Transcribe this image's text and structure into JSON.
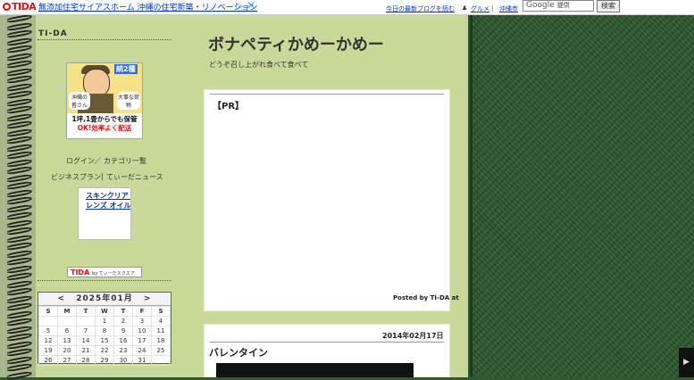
{
  "topbar": {
    "logo_text": "TIDA",
    "ad_text": "無添加住宅サイアスホーム 沖縄の住宅新築・リノベーション",
    "play_glyph": "▷",
    "close_glyph": "✕",
    "link_latest": "今日の最新ブログを読む",
    "link_gourmet": "グルメ",
    "separator": "|",
    "link_okinawa": "沖縄市",
    "search_brand": "Google",
    "search_provider": "提供",
    "search_button": "検索"
  },
  "sidebar": {
    "title": "TI-DA",
    "banner": {
      "tag": "続2種",
      "bubble_left": "沖縄の皆さん",
      "bubble_right": "大事な荷物",
      "line1": "1坪,1畳からでも保管",
      "line2": "OK!効率よく配送"
    },
    "login": "ログイン",
    "slash": "／",
    "category": "カテゴリ一覧",
    "business": "ビジネスプラン",
    "pipe": "|",
    "news": "てぃーだニュース",
    "ad_line1": "スキンクリア ク",
    "ad_line2": "レンズ オイル ",
    "badge_main": "TIDA",
    "badge_small": "by てぃーだスクエア",
    "calendar": {
      "prev": "<",
      "next": ">",
      "title": "2025年01月",
      "dow": [
        "S",
        "M",
        "T",
        "W",
        "T",
        "F",
        "S"
      ],
      "weeks": [
        [
          "",
          "",
          "",
          "1",
          "2",
          "3",
          "4"
        ],
        [
          "5",
          "6",
          "7",
          "8",
          "9",
          "10",
          "11"
        ],
        [
          "12",
          "13",
          "14",
          "15",
          "16",
          "17",
          "18"
        ],
        [
          "19",
          "20",
          "21",
          "22",
          "23",
          "24",
          "25"
        ],
        [
          "26",
          "27",
          "28",
          "29",
          "30",
          "31",
          ""
        ]
      ]
    }
  },
  "main": {
    "blog_title": "ボナペティかめーかめー",
    "blog_subtitle": "どうぞ召し上がれ食べて食べて",
    "pr_title": "【PR】",
    "posted_by": "Posted by TI-DA at",
    "post_date": "2014年02月17日",
    "post_title": "バレンタイン"
  },
  "right_tab_glyph": "▶"
}
